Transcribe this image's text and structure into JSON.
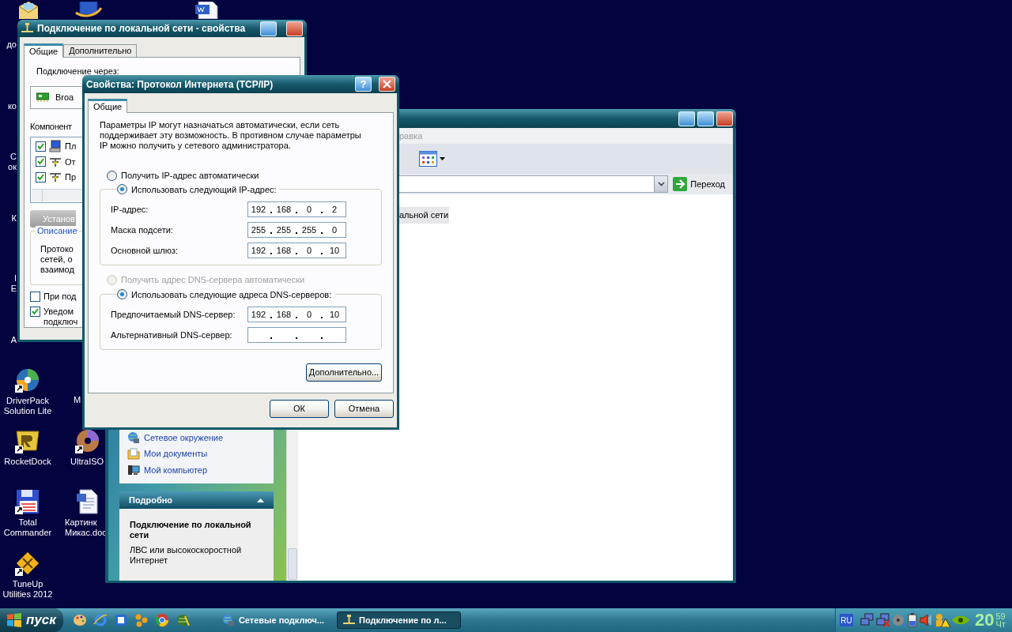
{
  "desktop_icons": [
    {
      "lines": [
        "DriverPack",
        "Solution Lite"
      ]
    },
    {
      "lines": [
        "RocketDock"
      ]
    },
    {
      "lines": [
        "UltraISO"
      ]
    },
    {
      "lines": [
        "Total",
        "Commander"
      ]
    },
    {
      "lines": [
        "Картинк",
        "Микас.doc"
      ]
    },
    {
      "lines": [
        "TuneUp",
        "Utilities 2012"
      ]
    }
  ],
  "desktop_label_fragments": [
    {
      "lines": [
        "до"
      ]
    },
    {
      "lines": [
        "ко"
      ]
    },
    {
      "lines": [
        "С",
        "ок"
      ]
    },
    {
      "lines": [
        "К"
      ]
    },
    {
      "lines": [
        "I",
        "E"
      ]
    },
    {
      "lines": [
        "А"
      ]
    },
    {
      "lines": [
        "М"
      ]
    }
  ],
  "explorer_window": {
    "menu_fragment": "равка",
    "go_button": "Переход",
    "list_item_fragment": "альной сети",
    "task_links": [
      "Сетевое окружение",
      "Мои документы",
      "Мой компьютер"
    ],
    "details": {
      "title": "Подробно",
      "expanded": true,
      "name": "Подключение по локальной сети",
      "type": "ЛВС или высокоскоростной Интернет"
    }
  },
  "properties_window": {
    "title": "Подключение по локальной сети - свойства",
    "tabs": [
      {
        "label": "Общие",
        "selected": true
      },
      {
        "label": "Дополнительно",
        "selected": false
      }
    ],
    "connect_label": "Подключение через:",
    "adapter_fragment": "Broa",
    "components_label": "Компонент",
    "components": [
      {
        "label": "Пл",
        "checked": true
      },
      {
        "label": "От",
        "checked": true
      },
      {
        "label": "Пр",
        "checked": true
      }
    ],
    "install_button_fragment": "Установ",
    "description_legend": "Описание",
    "description_lines": [
      "Протоко",
      "сетей, о",
      "взаимод"
    ],
    "options": [
      {
        "lines": [
          "При под"
        ],
        "checked": false
      },
      {
        "lines": [
          "Уведом",
          "подключ"
        ],
        "checked": true
      }
    ]
  },
  "tcpip_dialog": {
    "title": "Свойства: Протокол Интернета (TCP/IP)",
    "help_glyph": "?",
    "tabs": [
      {
        "label": "Общие",
        "selected": true
      }
    ],
    "intro": "Параметры IP могут назначаться автоматически, если сеть поддерживает эту возможность. В противном случае параметры IP можно получить у сетевого администратора.",
    "ip_auto": {
      "label": "Получить IP-адрес автоматически",
      "selected": false,
      "disabled": false
    },
    "ip_manual": {
      "label": "Использовать следующий IP-адрес:",
      "selected": true,
      "disabled": false
    },
    "ip_fields": [
      {
        "label": "IP-адрес:",
        "octets": [
          "192",
          "168",
          "0",
          "2"
        ]
      },
      {
        "label": "Маска подсети:",
        "octets": [
          "255",
          "255",
          "255",
          "0"
        ]
      },
      {
        "label": "Основной шлюз:",
        "octets": [
          "192",
          "168",
          "0",
          "10"
        ]
      }
    ],
    "dns_auto": {
      "label": "Получить адрес DNS-сервера автоматически",
      "selected": false,
      "disabled": true
    },
    "dns_manual": {
      "label": "Использовать следующие адреса DNS-серверов:",
      "selected": true,
      "disabled": false
    },
    "dns_fields": [
      {
        "label": "Предпочитаемый DNS-сервер:",
        "octets": [
          "192",
          "168",
          "0",
          "10"
        ]
      },
      {
        "label": "Альтернативный DNS-сервер:"
      }
    ],
    "advanced_button": "Дополнительно...",
    "ok_button": "ОК",
    "cancel_button": "Отмена"
  },
  "taskbar": {
    "start": "пуск",
    "tasks": [
      {
        "label": "Сетевые подключ...",
        "selected": false
      },
      {
        "label": "Подключение по л...",
        "selected": true
      }
    ],
    "language": "RU",
    "clock": {
      "hour": "20",
      "minute": "59",
      "day": "Чт"
    }
  }
}
